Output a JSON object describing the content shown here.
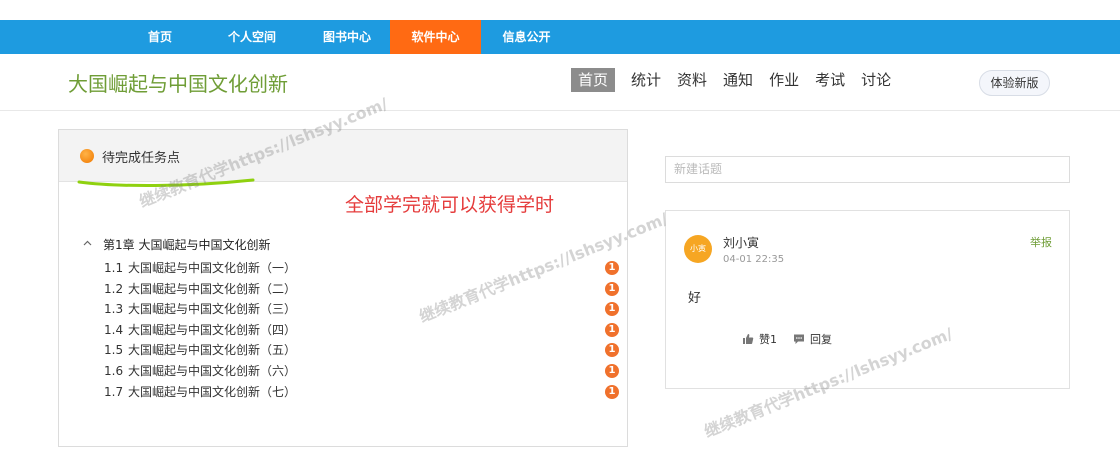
{
  "top_nav": [
    {
      "label": "首页",
      "active": false
    },
    {
      "label": "个人空间",
      "active": false
    },
    {
      "label": "图书中心",
      "active": false
    },
    {
      "label": "软件中心",
      "active": true
    },
    {
      "label": "信息公开",
      "active": false
    }
  ],
  "course_title": "大国崛起与中国文化创新",
  "sub_nav": [
    {
      "label": "首页",
      "active": true
    },
    {
      "label": "统计",
      "active": false
    },
    {
      "label": "资料",
      "active": false
    },
    {
      "label": "通知",
      "active": false
    },
    {
      "label": "作业",
      "active": false
    },
    {
      "label": "考试",
      "active": false
    },
    {
      "label": "讨论",
      "active": false
    }
  ],
  "new_version_label": "体验新版",
  "task_panel": {
    "header": "待完成任务点",
    "chapter": "第1章 大国崛起与中国文化创新",
    "lessons": [
      {
        "num": "1.1",
        "title": "大国崛起与中国文化创新（一）",
        "badge": "1"
      },
      {
        "num": "1.2",
        "title": "大国崛起与中国文化创新（二）",
        "badge": "1"
      },
      {
        "num": "1.3",
        "title": "大国崛起与中国文化创新（三）",
        "badge": "1"
      },
      {
        "num": "1.4",
        "title": "大国崛起与中国文化创新（四）",
        "badge": "1"
      },
      {
        "num": "1.5",
        "title": "大国崛起与中国文化创新（五）",
        "badge": "1"
      },
      {
        "num": "1.6",
        "title": "大国崛起与中国文化创新（六）",
        "badge": "1"
      },
      {
        "num": "1.7",
        "title": "大国崛起与中国文化创新（七）",
        "badge": "1"
      }
    ]
  },
  "annotation_text": "全部学完就可以获得学时",
  "topic_input_placeholder": "新建话题",
  "post": {
    "avatar_text": "小寅",
    "author": "刘小寅",
    "time": "04-01 22:35",
    "report_label": "举报",
    "body": "好",
    "like_label": "赞1",
    "reply_label": "回复"
  },
  "watermark": "继续教育代学https://lshsyy.com/",
  "colors": {
    "topbar": "#1e9be0",
    "active_tab": "#ff6a13",
    "title_green": "#6f9d36",
    "badge": "#f0712c",
    "annotation_red": "#e53c3c"
  }
}
